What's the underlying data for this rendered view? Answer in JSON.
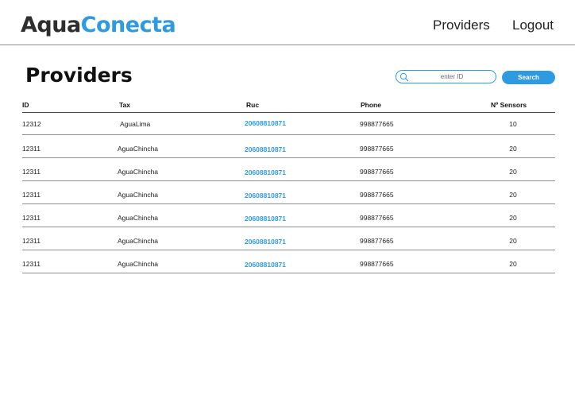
{
  "brand": {
    "part1": "Aqua",
    "part2": "Conecta",
    "color_dark": "#2e2e2e",
    "color_accent": "#2e9be0"
  },
  "nav": {
    "providers": "Providers",
    "logout": "Logout"
  },
  "page": {
    "title": "Providers"
  },
  "search": {
    "placeholder": "enter ID",
    "button": "Search",
    "icon": "search-icon"
  },
  "table": {
    "headers": {
      "id": "ID",
      "tax": "Tax",
      "ruc": "Ruc",
      "phone": "Phone",
      "sensors": "Nº Sensors"
    },
    "rows": [
      {
        "id": "12312",
        "tax": "AguaLima",
        "ruc": "20608810871",
        "phone": "998877665",
        "sensors": "10"
      },
      {
        "id": "12311",
        "tax": "AguaChincha",
        "ruc": "20608810871",
        "phone": "998877665",
        "sensors": "20"
      },
      {
        "id": "12311",
        "tax": "AguaChincha",
        "ruc": "20608810871",
        "phone": "998877665",
        "sensors": "20"
      },
      {
        "id": "12311",
        "tax": "AguaChincha",
        "ruc": "20608810871",
        "phone": "998877665",
        "sensors": "20"
      },
      {
        "id": "12311",
        "tax": "AguaChincha",
        "ruc": "20608810871",
        "phone": "998877665",
        "sensors": "20"
      },
      {
        "id": "12311",
        "tax": "AguaChincha",
        "ruc": "20608810871",
        "phone": "998877665",
        "sensors": "20"
      },
      {
        "id": "12311",
        "tax": "AguaChincha",
        "ruc": "20608810871",
        "phone": "998877665",
        "sensors": "20"
      }
    ]
  }
}
